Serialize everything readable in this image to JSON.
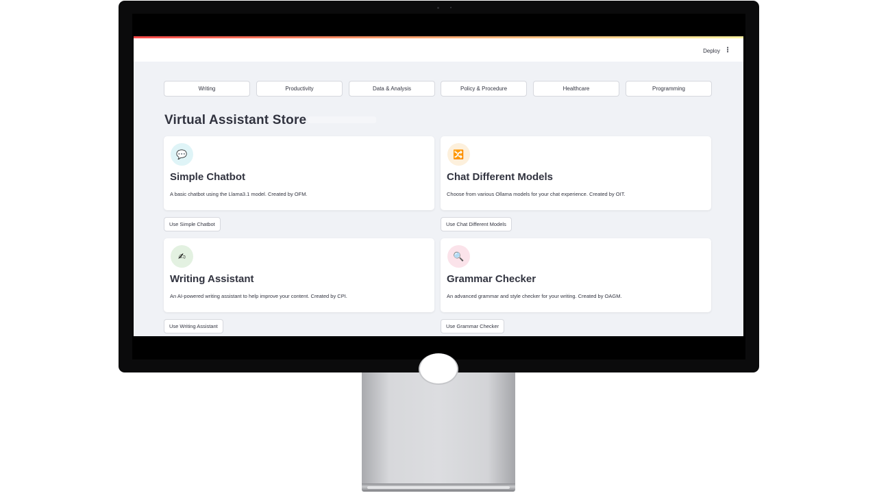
{
  "header": {
    "deploy_label": "Deploy",
    "menu_icon": "⋮"
  },
  "categories": [
    "Writing",
    "Productivity",
    "Data & Analysis",
    "Policy & Procedure",
    "Healthcare",
    "Programming"
  ],
  "page_title": "Virtual Assistant Store",
  "assistants": [
    {
      "title": "Simple Chatbot",
      "description": "A basic chatbot using the Llama3.1 model. Created by OFM.",
      "button": "Use Simple Chatbot",
      "icon": "speech-bubble-icon",
      "icon_glyph": "💬",
      "icon_bg": "#dff4f7"
    },
    {
      "title": "Chat Different Models",
      "description": "Choose from various Ollama models for your chat experience. Created by OIT.",
      "button": "Use Chat Different Models",
      "icon": "shuffle-icon",
      "icon_glyph": "🔀",
      "icon_bg": "#fdf0dc"
    },
    {
      "title": "Writing Assistant",
      "description": "An AI-powered writing assistant to help improve your content. Created by CPI.",
      "button": "Use Writing Assistant",
      "icon": "writing-hand-icon",
      "icon_glyph": "✍",
      "icon_bg": "#e3f1e1"
    },
    {
      "title": "Grammar Checker",
      "description": "An advanced grammar and style checker for your writing. Created by OAGM.",
      "button": "Use Grammar Checker",
      "icon": "magnifier-icon",
      "icon_glyph": "🔍",
      "icon_bg": "#fbe3ea"
    }
  ]
}
